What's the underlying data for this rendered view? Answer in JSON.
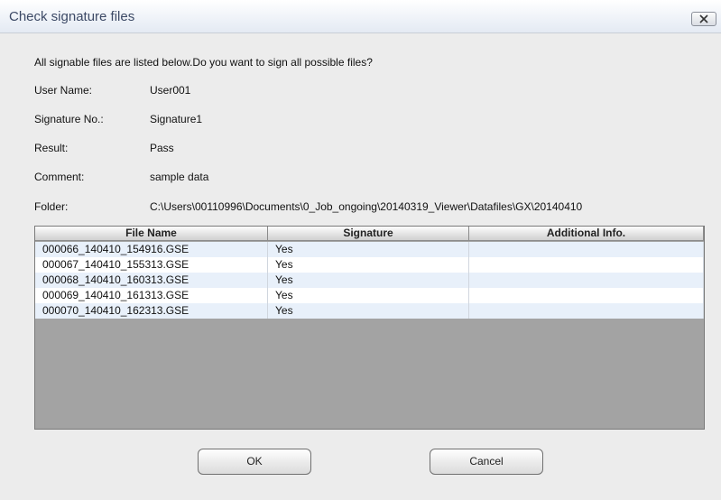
{
  "window": {
    "title": "Check signature files"
  },
  "intro_text": "All signable files are listed below.Do you want to sign all possible files?",
  "fields": {
    "user_name": {
      "label": "User Name:",
      "value": "User001"
    },
    "signature_no": {
      "label": "Signature No.:",
      "value": "Signature1"
    },
    "result": {
      "label": "Result:",
      "value": "Pass"
    },
    "comment": {
      "label": "Comment:",
      "value": "sample data"
    },
    "folder": {
      "label": "Folder:",
      "value": "C:\\Users\\00110996\\Documents\\0_Job_ongoing\\20140319_Viewer\\Datafiles\\GX\\20140410"
    }
  },
  "table": {
    "columns": [
      "File Name",
      "Signature",
      "Additional Info."
    ],
    "rows": [
      [
        "000066_140410_154916.GSE",
        "Yes",
        ""
      ],
      [
        "000067_140410_155313.GSE",
        "Yes",
        ""
      ],
      [
        "000068_140410_160313.GSE",
        "Yes",
        ""
      ],
      [
        "000069_140410_161313.GSE",
        "Yes",
        ""
      ],
      [
        "000070_140410_162313.GSE",
        "Yes",
        ""
      ]
    ]
  },
  "buttons": {
    "ok": "OK",
    "cancel": "Cancel"
  }
}
